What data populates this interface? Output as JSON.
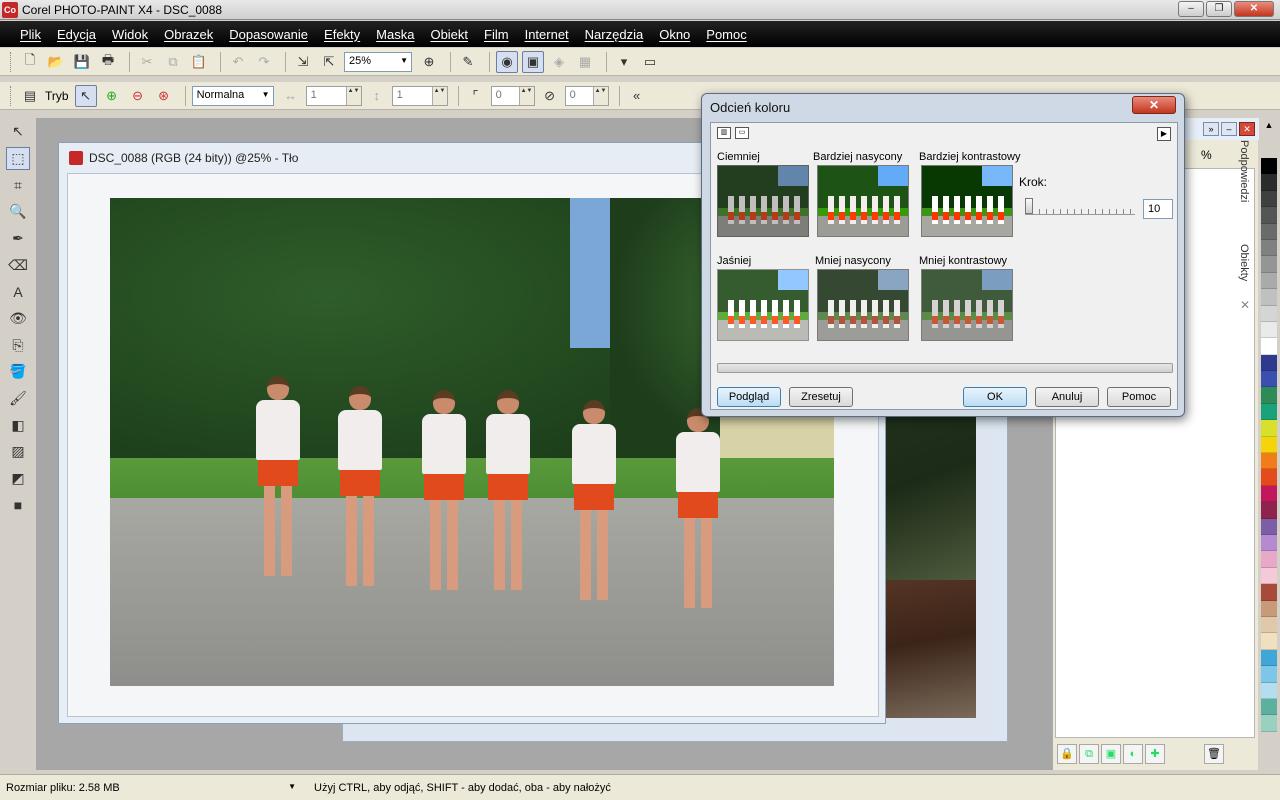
{
  "window": {
    "title": "Corel PHOTO-PAINT X4 - DSC_0088",
    "app_icon": "corel-icon"
  },
  "menu": [
    "Plik",
    "Edycja",
    "Widok",
    "Obrazek",
    "Dopasowanie",
    "Efekty",
    "Maska",
    "Obiekt",
    "Film",
    "Internet",
    "Narzędzia",
    "Okno",
    "Pomoc"
  ],
  "toolbar": {
    "zoom": "25%"
  },
  "propertybar": {
    "mode_label": "Tryb",
    "merge_mode": "Normalna",
    "width_value": "1",
    "height_value": "1",
    "feather_value": "0",
    "transparency_value": "0"
  },
  "document": {
    "title": "DSC_0088 (RGB (24 bity)) @25% - Tło"
  },
  "dialog": {
    "title": "Odcień koloru",
    "close_label": "✕",
    "thumbnails": [
      {
        "label": "Ciemniej",
        "effect": "dark"
      },
      {
        "label": "Bardziej nasycony",
        "effect": "sat"
      },
      {
        "label": "Bardziej kontrastowy",
        "effect": "hicon"
      },
      {
        "label": "Jaśniej",
        "effect": "light"
      },
      {
        "label": "Mniej nasycony",
        "effect": "desat"
      },
      {
        "label": "Mniej kontrastowy",
        "effect": "locon"
      }
    ],
    "step_label": "Krok:",
    "step_value": "10",
    "buttons": {
      "preview": "Podgląd",
      "reset": "Zresetuj",
      "ok": "OK",
      "cancel": "Anuluj",
      "help": "Pomoc"
    }
  },
  "dock": {
    "tabs": [
      "Podpowiedzi",
      "Obiekty"
    ],
    "percent_label": "%"
  },
  "palette": [
    "#000000",
    "#2b2b2b",
    "#404040",
    "#555555",
    "#6a6a6a",
    "#808080",
    "#959595",
    "#aaaaaa",
    "#c0c0c0",
    "#d5d5d5",
    "#eaeaea",
    "#ffffff",
    "#2f3a8f",
    "#3a4fb0",
    "#2e8b57",
    "#1aa37a",
    "#d7e02a",
    "#f5d50a",
    "#f07c1a",
    "#e34a1d",
    "#c2185b",
    "#8e244d",
    "#7b5ea7",
    "#b58ad0",
    "#e8a8c8",
    "#f6c9d9",
    "#a84a3a",
    "#c89b78",
    "#e0c8a8",
    "#f0e0c0",
    "#3fa6d8",
    "#7cc6e8",
    "#b4def0",
    "#5bb0a0",
    "#9ad0c0"
  ],
  "status": {
    "file_size": "Rozmiar pliku: 2.58 MB",
    "hint": "Użyj CTRL, aby odjąć, SHIFT - aby dodać, oba - aby nałożyć"
  }
}
